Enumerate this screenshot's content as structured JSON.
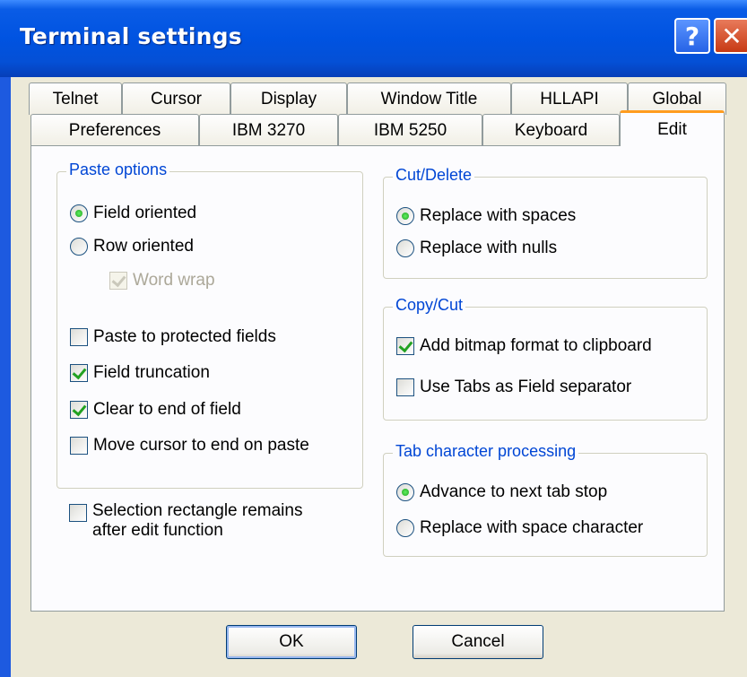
{
  "window": {
    "title": "Terminal settings"
  },
  "titlebar_buttons": {
    "help": "?",
    "close": "✕"
  },
  "tabs_back": [
    "Telnet",
    "Cursor",
    "Display",
    "Window Title",
    "HLLAPI",
    "Global"
  ],
  "tabs_front": [
    "Preferences",
    "IBM 3270",
    "IBM 5250",
    "Keyboard",
    "Edit"
  ],
  "active_tab": "Edit",
  "paste_options": {
    "label": "Paste options",
    "field_oriented": "Field oriented",
    "row_oriented": "Row oriented",
    "word_wrap": "Word wrap",
    "paste_protected": "Paste to protected fields",
    "field_truncation": "Field truncation",
    "clear_to_end": "Clear to end of field",
    "move_cursor": "Move cursor to end on paste"
  },
  "selection_rect": {
    "line1": "Selection rectangle remains",
    "line2": "after edit function"
  },
  "cut_delete": {
    "label": "Cut/Delete",
    "replace_spaces": "Replace with spaces",
    "replace_nulls": "Replace with nulls"
  },
  "copy_cut": {
    "label": "Copy/Cut",
    "add_bitmap": "Add bitmap format to clipboard",
    "use_tabs": "Use Tabs as Field separator"
  },
  "tab_processing": {
    "label": "Tab character processing",
    "advance": "Advance to next tab stop",
    "replace_space": "Replace with space character"
  },
  "buttons": {
    "ok": "OK",
    "cancel": "Cancel"
  },
  "colors": {
    "titlebar": "#0053e1",
    "group_label": "#0046d5",
    "active_tab_accent": "#ff9c1f",
    "check": "#21a121"
  }
}
